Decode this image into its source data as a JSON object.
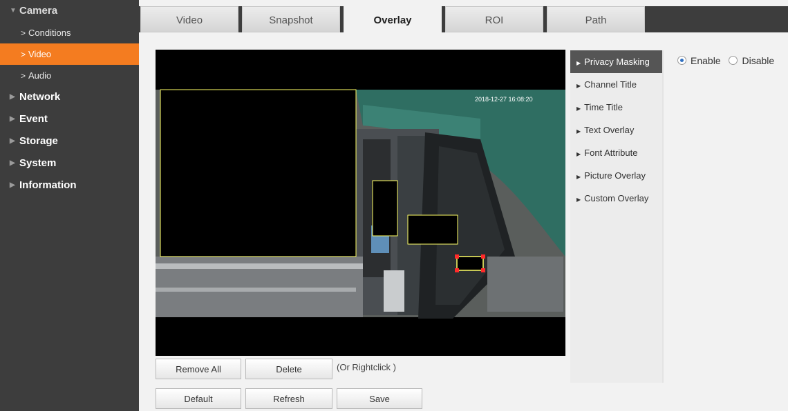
{
  "sidebar": {
    "camera": "Camera",
    "sub_items": [
      {
        "label": "Conditions"
      },
      {
        "label": "Video"
      },
      {
        "label": "Audio"
      }
    ],
    "top_items": [
      {
        "label": "Network"
      },
      {
        "label": "Event"
      },
      {
        "label": "Storage"
      },
      {
        "label": "System"
      },
      {
        "label": "Information"
      }
    ]
  },
  "tabs": [
    {
      "label": "Video"
    },
    {
      "label": "Snapshot"
    },
    {
      "label": "Overlay"
    },
    {
      "label": "ROI"
    },
    {
      "label": "Path"
    }
  ],
  "active_tab": "Overlay",
  "video": {
    "timestamp": "2018-12-27 16:08:20"
  },
  "side_menu": [
    {
      "label": "Privacy Masking"
    },
    {
      "label": "Channel Title"
    },
    {
      "label": "Time Title"
    },
    {
      "label": "Text Overlay"
    },
    {
      "label": "Font Attribute"
    },
    {
      "label": "Picture Overlay"
    },
    {
      "label": "Custom Overlay"
    }
  ],
  "privacy": {
    "enable_label": "Enable",
    "disable_label": "Disable",
    "selected": "Enable"
  },
  "buttons": {
    "remove_all": "Remove All",
    "delete": "Delete",
    "hint": "(Or Rightclick )",
    "default": "Default",
    "refresh": "Refresh",
    "save": "Save"
  },
  "colors": {
    "accent": "#f47c20",
    "sidebar_bg": "#3d3d3d",
    "mask_border": "#ffff66",
    "handle": "#ff2a2a"
  }
}
